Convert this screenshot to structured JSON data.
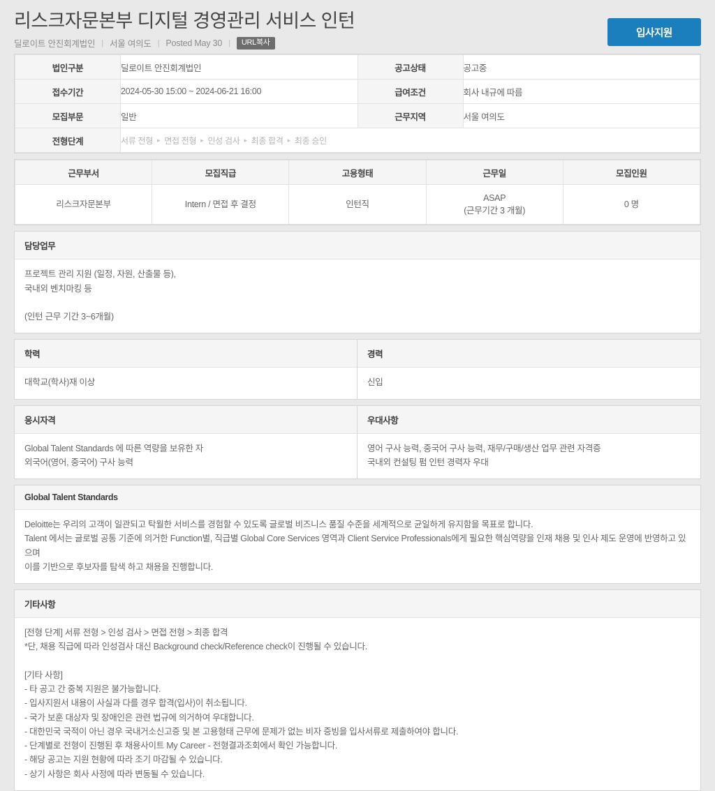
{
  "header": {
    "title": "리스크자문본부 디지털 경영관리 서비스 인턴",
    "company": "딜로이트 안진회계법인",
    "location": "서울 여의도",
    "posted": "Posted May 30",
    "url_copy_label": "URL복사",
    "apply_label": "입사지원",
    "separator": "|",
    "accent_color": "#1b7fbd"
  },
  "info_table": {
    "rows": [
      {
        "left_label": "법인구분",
        "left_value": "딜로이트 안진회계법인",
        "right_label": "공고상태",
        "right_value": "공고중"
      },
      {
        "left_label": "접수기간",
        "left_value": "2024-05-30 15:00 ~ 2024-06-21 16:00",
        "right_label": "급여조건",
        "right_value": "회사 내규에 따름"
      },
      {
        "left_label": "모집부문",
        "left_value": "일반",
        "right_label": "근무지역",
        "right_value": "서울 여의도"
      }
    ],
    "stage_label": "전형단계",
    "stages": [
      "서류 전형",
      "면접 전형",
      "인성 검사",
      "최종 합격",
      "최종 승인"
    ],
    "stage_arrow": "▸"
  },
  "position_table": {
    "headers": [
      "근무부서",
      "모집직급",
      "고용형태",
      "근무일",
      "모집인원"
    ],
    "values": [
      "리스크자문본부",
      "Intern / 면접 후 결정",
      "인턴직",
      "ASAP\n(근무기간 3 개월)",
      "0 명"
    ]
  },
  "sections": {
    "duties": {
      "title": "담당업무",
      "body": "프로젝트 관리 지원 (일정, 자원, 산출물 등),\n국내외 벤치마킹 등\n\n(인턴 근무 기간 3~6개월)"
    },
    "education": {
      "title": "학력",
      "body": "대학교(학사)재 이상"
    },
    "experience": {
      "title": "경력",
      "body": "신입"
    },
    "qualification": {
      "title": "응시자격",
      "body": "Global Talent Standards 에 따른 역량을 보유한 자\n외국어(영어, 중국어) 구사 능력"
    },
    "preferred": {
      "title": "우대사항",
      "body": "영어 구사 능력, 중국어 구사 능력, 재무/구매/생산 업무 관련 자격증\n국내외 컨설팅 펌 인턴 경력자 우대"
    },
    "gts": {
      "title": "Global Talent Standards",
      "body": "Deloitte는 우리의 고객이 일관되고 탁월한 서비스를 경험할 수 있도록 글로벌 비즈니스 품질 수준을 세계적으로 균일하게 유지함을 목표로 합니다.\nTalent 에서는 글로벌 공통 기준에 의거한 Function별, 직급별 Global Core Services 영역과 Client Service Professionals에게 필요한 핵심역량을 인재 채용 및 인사 제도 운영에 반영하고 있으며\n이를 기반으로 후보자를 탐색 하고 채용을 진행합니다."
    },
    "etc": {
      "title": "기타사항",
      "body": "[전형 단계] 서류 전형 > 인성 검사 > 면접 전형 > 최종 합격\n*단, 채용 직급에 따라 인성검사 대신 Background check/Reference check이 진행될 수 있습니다.\n\n[기타 사항]\n- 타 공고 간 중복 지원은 불가능합니다.\n- 입사지원서 내용이 사실과 다를 경우 합격(입사)이 취소됩니다.\n- 국가 보훈 대상자 및 장애인은 관련 법규에 의거하여 우대합니다.\n- 대한민국 국적이 아닌 경우 국내거소신고증 및 본 고용형태 근무에 문제가 없는 비자 증빙을 입사서류로 제출하여야 합니다.\n- 단계별로 전형이 진행된 후 채용사이트 My Career - 전형결과조회에서 확인 가능합니다.\n- 해당 공고는 지원 현황에 따라 조기 마감될 수 있습니다.\n- 상기 사항은 회사 사정에 따라 변동될 수 있습니다."
    }
  }
}
